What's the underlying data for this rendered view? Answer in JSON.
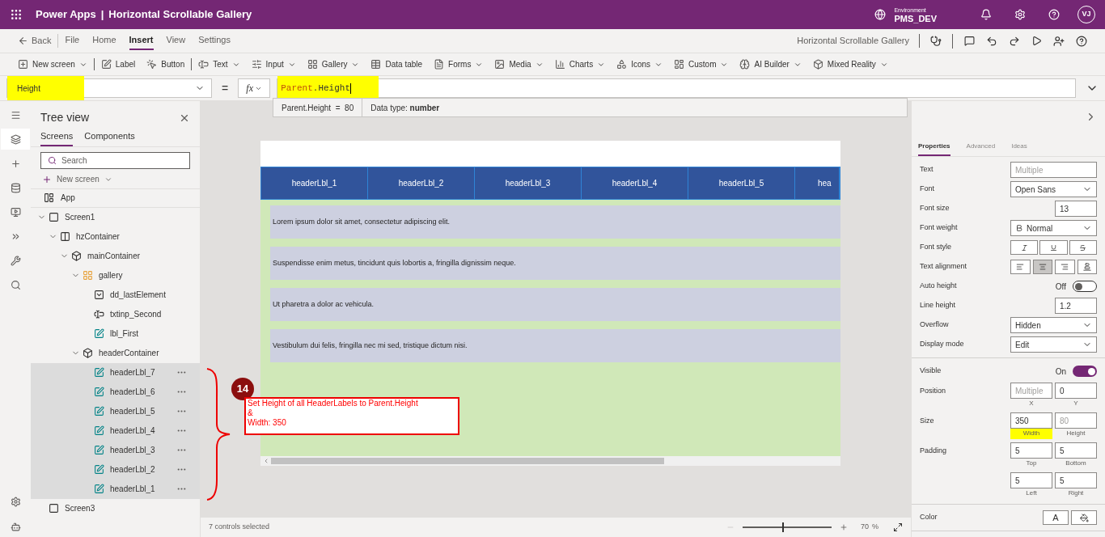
{
  "title_bar": {
    "app": "Power Apps",
    "separator": "|",
    "title": "Horizontal Scrollable Gallery",
    "environment_label": "Environment",
    "environment": "PMS_DEV",
    "avatar": "VJ"
  },
  "menu_bar": {
    "back": "Back",
    "tabs": [
      {
        "label": "File",
        "selected": false
      },
      {
        "label": "Home",
        "selected": false
      },
      {
        "label": "Insert",
        "selected": true
      },
      {
        "label": "View",
        "selected": false
      },
      {
        "label": "Settings",
        "selected": false
      }
    ],
    "app_name": "Horizontal Scrollable Gallery"
  },
  "ribbon": {
    "groups": [
      [
        {
          "label": "New screen",
          "dropdown": true
        }
      ],
      [
        {
          "label": "Label",
          "dropdown": false
        },
        {
          "label": "Button",
          "dropdown": false
        }
      ],
      [
        {
          "label": "Text",
          "dropdown": true
        },
        {
          "label": "Input",
          "dropdown": true
        },
        {
          "label": "Gallery",
          "dropdown": true
        },
        {
          "label": "Data table",
          "dropdown": false
        },
        {
          "label": "Forms",
          "dropdown": true
        },
        {
          "label": "Media",
          "dropdown": true
        },
        {
          "label": "Charts",
          "dropdown": true
        },
        {
          "label": "Icons",
          "dropdown": true
        },
        {
          "label": "Custom",
          "dropdown": true
        },
        {
          "label": "AI Builder",
          "dropdown": true
        },
        {
          "label": "Mixed Reality",
          "dropdown": true
        }
      ]
    ]
  },
  "formula_bar": {
    "property": "Height",
    "property_highlighted": true,
    "equals": "=",
    "fx": "fx",
    "tokens": [
      {
        "text": "Parent",
        "kind": "identifier"
      },
      {
        "text": ".Height",
        "kind": "member"
      }
    ],
    "formula_highlighted": true,
    "hint": {
      "expression": "Parent.Height  =  80",
      "data_type": "Data type: **number**"
    }
  },
  "left_rail": [
    {
      "selected": false
    },
    {
      "selected": true
    },
    {
      "selected": false
    },
    {
      "selected": false
    },
    {
      "selected": false
    },
    {
      "selected": false
    },
    {
      "selected": false
    },
    {
      "selected": false
    }
  ],
  "tree_view": {
    "title": "Tree view",
    "tabs": [
      {
        "label": "Screens",
        "selected": true
      },
      {
        "label": "Components",
        "selected": false
      }
    ],
    "search": {
      "placeholder": "Search"
    },
    "new_screen": "New screen",
    "app": "App",
    "items": [
      {
        "label": "Screen1",
        "kind": "screen",
        "expanded": true,
        "selected": false,
        "children": [
          {
            "label": "hzContainer",
            "kind": "hcontainer",
            "expanded": true,
            "selected": false,
            "children": [
              {
                "label": "mainContainer",
                "kind": "container",
                "expanded": true,
                "selected": false,
                "children": [
                  {
                    "label": "gallery",
                    "kind": "gallery",
                    "expanded": true,
                    "selected": false,
                    "children": [
                      {
                        "label": "dd_lastElement",
                        "kind": "dropdown",
                        "selected": false
                      },
                      {
                        "label": "txtinp_Second",
                        "kind": "textinput",
                        "selected": false
                      },
                      {
                        "label": "lbl_First",
                        "kind": "label",
                        "selected": false
                      }
                    ]
                  },
                  {
                    "label": "headerContainer",
                    "kind": "container",
                    "expanded": true,
                    "selected": false,
                    "children": [
                      {
                        "label": "headerLbl_7",
                        "kind": "label",
                        "selected": true
                      },
                      {
                        "label": "headerLbl_6",
                        "kind": "label",
                        "selected": true
                      },
                      {
                        "label": "headerLbl_5",
                        "kind": "label",
                        "selected": true
                      },
                      {
                        "label": "headerLbl_4",
                        "kind": "label",
                        "selected": true
                      },
                      {
                        "label": "headerLbl_3",
                        "kind": "label",
                        "selected": true
                      },
                      {
                        "label": "headerLbl_2",
                        "kind": "label",
                        "selected": true
                      },
                      {
                        "label": "headerLbl_1",
                        "kind": "label",
                        "selected": true
                      }
                    ]
                  }
                ]
              }
            ]
          }
        ]
      },
      {
        "label": "Screen3",
        "kind": "screen",
        "selected": false
      }
    ]
  },
  "canvas": {
    "header_labels": [
      "headerLbl_1",
      "headerLbl_2",
      "headerLbl_3",
      "headerLbl_4",
      "headerLbl_5",
      "hea"
    ],
    "rows": [
      "Lorem ipsum dolor sit amet, consectetur adipiscing elit.",
      "Suspendisse enim metus, tincidunt quis lobortis a, fringilla dignissim neque.",
      "Ut pharetra a dolor ac vehicula.",
      "Vestibulum dui felis, fringilla nec mi sed, tristique dictum nisi."
    ]
  },
  "annotation": {
    "number": "14",
    "lines": [
      "Set Height of all HeaderLabels to Parent.Height",
      "&",
      "Width: 350"
    ]
  },
  "properties": {
    "tabs": [
      {
        "label": "Properties",
        "selected": true
      },
      {
        "label": "Advanced",
        "selected": false
      },
      {
        "label": "Ideas",
        "selected": false
      }
    ],
    "sections": [
      {
        "rows": [
          {
            "label": "Text",
            "kind": "field",
            "value": "Multiple",
            "muted": true
          },
          {
            "label": "Font",
            "kind": "dropdown",
            "value": "Open Sans"
          },
          {
            "label": "Font size",
            "kind": "short",
            "value": "13"
          },
          {
            "label": "Font weight",
            "kind": "weight",
            "value": "Normal"
          },
          {
            "label": "Font style",
            "kind": "font_style"
          },
          {
            "label": "Text alignment",
            "kind": "alignment",
            "options": [
              {
                "selected": false
              },
              {
                "selected": true
              },
              {
                "selected": false
              },
              {
                "selected": false
              }
            ]
          },
          {
            "label": "Auto height",
            "kind": "toggle",
            "state": "Off",
            "on": false
          },
          {
            "label": "Line height",
            "kind": "short",
            "value": "1.2"
          },
          {
            "label": "Overflow",
            "kind": "dropdown",
            "value": "Hidden"
          },
          {
            "label": "Display mode",
            "kind": "dropdown",
            "value": "Edit"
          }
        ]
      },
      {
        "rows": [
          {
            "label": "Visible",
            "kind": "toggle",
            "state": "On",
            "on": true
          },
          {
            "label": "Position",
            "kind": "pair",
            "fields": [
              {
                "value": "Multiple",
                "caption": "X",
                "muted": true,
                "highlighted": false
              },
              {
                "value": "0",
                "caption": "Y",
                "muted": false,
                "highlighted": false
              }
            ]
          },
          {
            "label": "Size",
            "kind": "pair",
            "fields": [
              {
                "value": "350",
                "caption": "Width",
                "muted": false,
                "highlighted": true
              },
              {
                "value": "80",
                "caption": "Height",
                "muted": true,
                "highlighted": false
              }
            ]
          },
          {
            "label": "Padding",
            "kind": "pair",
            "fields": [
              {
                "value": "5",
                "caption": "Top",
                "muted": false,
                "highlighted": false
              },
              {
                "value": "5",
                "caption": "Bottom",
                "muted": false,
                "highlighted": false
              }
            ]
          },
          {
            "kind": "pair",
            "fields": [
              {
                "value": "5",
                "caption": "Left",
                "muted": false,
                "highlighted": false
              },
              {
                "value": "5",
                "caption": "Right",
                "muted": false,
                "highlighted": false
              }
            ]
          }
        ]
      },
      {
        "rows": [
          {
            "label": "Color",
            "kind": "color",
            "glyph": "A"
          }
        ]
      }
    ]
  },
  "status_bar": {
    "text": "7 controls selected",
    "zoom": "70",
    "unit": "%",
    "level": 0.45
  }
}
